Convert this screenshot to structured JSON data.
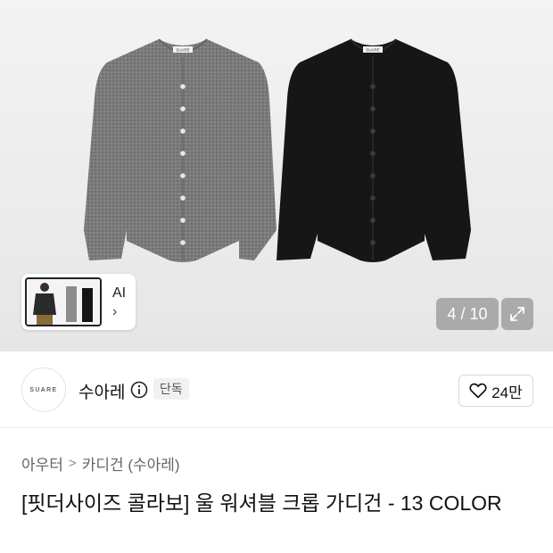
{
  "hero": {
    "garment_logo": "SUARE",
    "related": {
      "label": "AI",
      "chevron": "›"
    },
    "counter": "4 / 10",
    "icons": {
      "expand": "expand-icon",
      "chevron": "chevron-right-icon"
    },
    "colors": {
      "grey_cardigan": "#7a7a7a",
      "black_cardigan": "#161616"
    }
  },
  "brand": {
    "logo_text": "SUARE",
    "name": "수아레",
    "badge": "단독",
    "likes": "24만",
    "icons": {
      "info": "info-icon",
      "heart": "heart-icon"
    }
  },
  "breadcrumb": {
    "items": [
      "아우터",
      "카디건 (수아레)"
    ],
    "separator": ">"
  },
  "product": {
    "title": "[핏더사이즈 콜라보] 울 워셔블 크롭 가디건 - 13 COLOR"
  }
}
